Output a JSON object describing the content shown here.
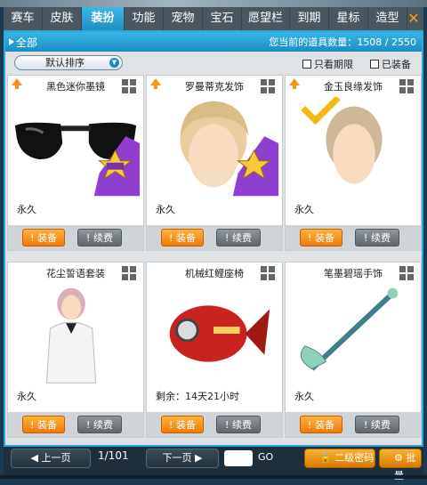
{
  "tabs": [
    "赛车",
    "皮肤",
    "装扮",
    "功能",
    "宠物",
    "宝石",
    "愿望栏",
    "到期",
    "星标",
    "造型"
  ],
  "active_tab_index": 2,
  "info": {
    "filter_label": "全部",
    "count_label": "您当前的道具数量：",
    "count_value": "1508 / 2550"
  },
  "filters": {
    "sort_label": "默认排序",
    "expiring_label": "只看期限",
    "equipped_label": "已装备"
  },
  "items": [
    {
      "name": "黑色迷你墨镜",
      "duration": "永久",
      "equip": "装备",
      "renew": "续费",
      "has_arrow": true
    },
    {
      "name": "罗曼蒂克发饰",
      "duration": "永久",
      "equip": "装备",
      "renew": "续费",
      "has_arrow": true
    },
    {
      "name": "金玉良缘发饰",
      "duration": "永久",
      "equip": "装备",
      "renew": "续费",
      "has_arrow": true
    },
    {
      "name": "花尘誓语套装",
      "duration": "永久",
      "equip": "装备",
      "renew": "续费",
      "has_arrow": false
    },
    {
      "name": "机械红鲤座椅",
      "duration": "剩余：14天21小时",
      "equip": "装备",
      "renew": "续费",
      "has_arrow": false
    },
    {
      "name": "笔墨碧瑶手饰",
      "duration": "永久",
      "equip": "装备",
      "renew": "续费",
      "has_arrow": false
    }
  ],
  "pager": {
    "prev": "上一页",
    "page": "1/101",
    "next": "下一页",
    "go": "GO"
  },
  "actions": {
    "password": "二级密码",
    "batch": "批量"
  },
  "close_glyph": "✕",
  "colors": {
    "tab_active": "#2aa3dc",
    "equip_btn": "#f39019",
    "renew_btn": "#6f777d",
    "panel_border": "#2ea6da"
  }
}
